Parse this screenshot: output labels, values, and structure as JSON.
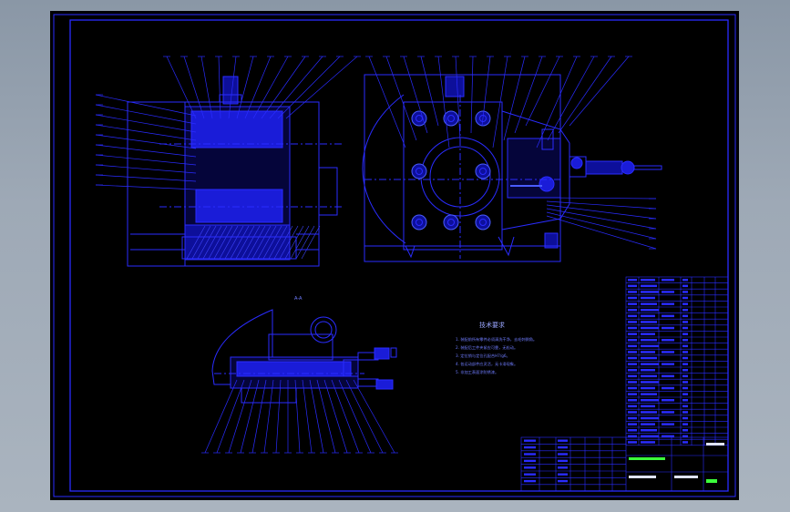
{
  "colors": {
    "background": "#000000",
    "line": "#2a2cff",
    "bright": "#4a5cff",
    "text": "#9aa6ff",
    "accent_green": "#3cff3c",
    "white": "#dfe3ff",
    "window": "#9ea9b6"
  },
  "drawing": {
    "tech_title": "技术要求",
    "tech_notes": [
      "1. 装配前所有零件必须清洗干净，去毛刺倒角。",
      "2. 装配后工件夹紧应可靠，无松动。",
      "3. 定位销与定位孔配合H7/g6。",
      "4. 各运动部件应灵活，无卡滞现象。",
      "5. 非加工表面涂防锈漆。"
    ],
    "section_mark": "A-A"
  }
}
